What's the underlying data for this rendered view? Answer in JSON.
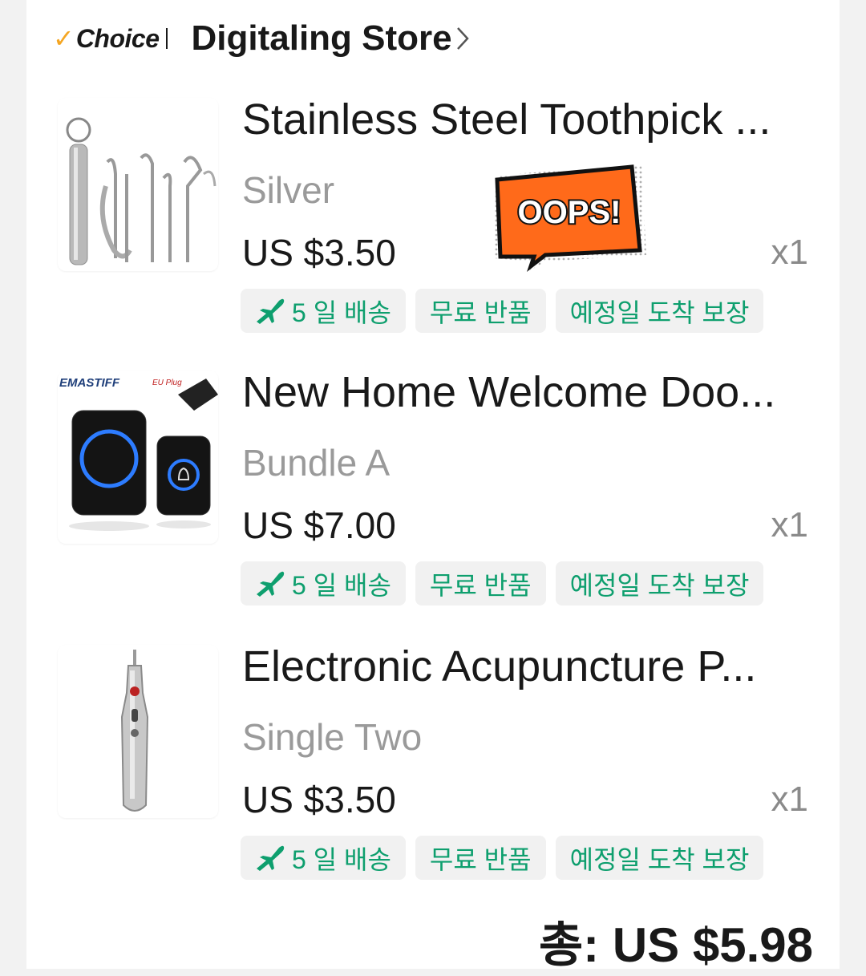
{
  "store": {
    "choice_label": "Choice",
    "name": "Digitaling Store"
  },
  "items": [
    {
      "title": "Stainless Steel Toothpick ...",
      "variant": "Silver",
      "price": "US $3.50",
      "qty": "x1",
      "tags": [
        "5 일 배송",
        "무료 반품",
        "예정일 도착 보장"
      ],
      "thumb_icon": "toothpick-set-image"
    },
    {
      "title": "New Home Welcome Doo...",
      "variant": "Bundle A",
      "price": "US $7.00",
      "qty": "x1",
      "tags": [
        "5 일 배송",
        "무료 반품",
        "예정일 도착 보장"
      ],
      "thumb_icon": "doorbell-image",
      "thumb_brand": "EMASTIFF",
      "thumb_plug": "EU Plug"
    },
    {
      "title": "Electronic Acupuncture P...",
      "variant": "Single Two",
      "price": "US $3.50",
      "qty": "x1",
      "tags": [
        "5 일 배송",
        "무료 반품",
        "예정일 도착 보장"
      ],
      "thumb_icon": "acupuncture-pen-image"
    }
  ],
  "sticker": {
    "text": "OOPS!"
  },
  "total": {
    "label": "총:",
    "value": "US $5.98"
  },
  "colors": {
    "tag_text": "#0e9f6e",
    "tag_bg": "#f1f1f1",
    "choice_check": "#f5a623",
    "sticker_bg": "#ff6a1a"
  }
}
